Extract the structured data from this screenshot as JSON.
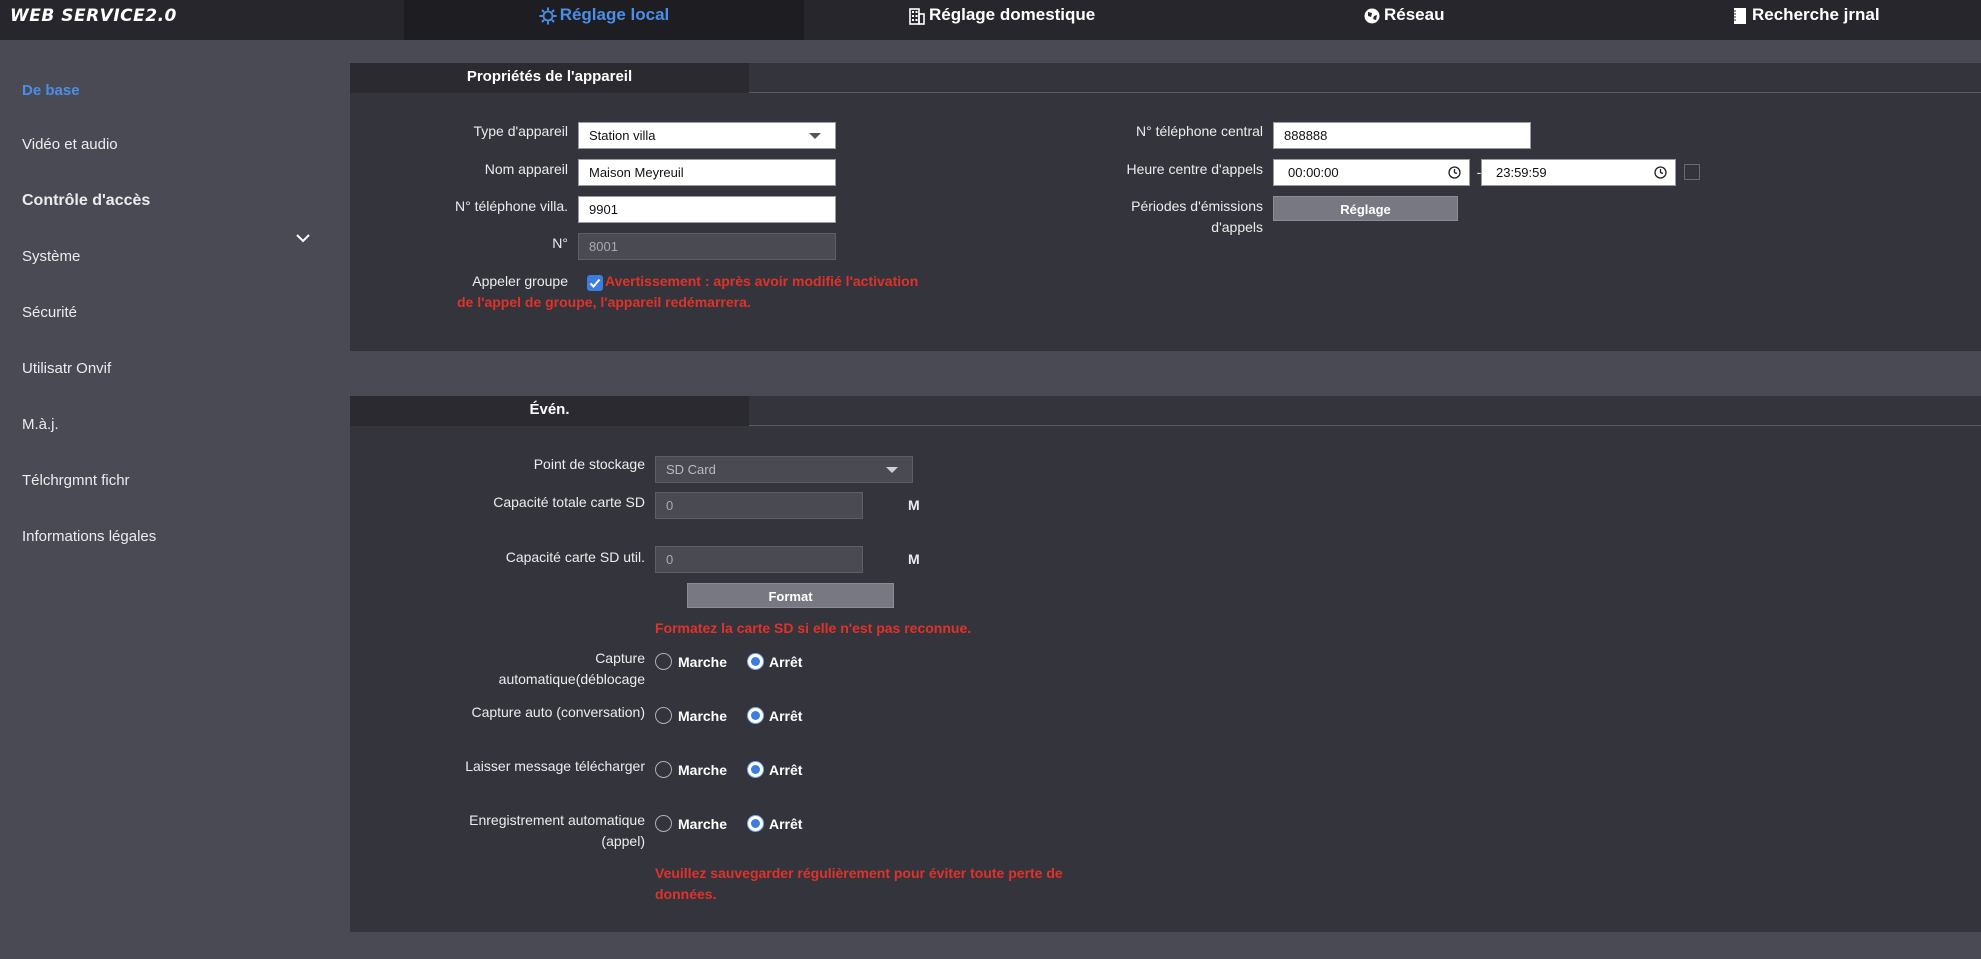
{
  "brand": "WEB SERVICE2.0",
  "tabs": {
    "local": "Réglage local",
    "domestic": "Réglage domestique",
    "network": "Réseau",
    "log": "Recherche jrnal"
  },
  "sidebar": {
    "items": [
      "De base",
      "Vidéo et audio",
      "Contrôle d'accès",
      "Système",
      "Sécurité",
      "Utilisatr Onvif",
      "M.à.j.",
      "Télchrgmnt fichr",
      "Informations légales"
    ]
  },
  "device": {
    "tab": "Propriétés de l'appareil",
    "type_label": "Type d'appareil",
    "type_value": "Station villa",
    "name_label": "Nom appareil",
    "name_value": "Maison Meyreuil",
    "villa_label": "N° téléphone villa.",
    "villa_value": "9901",
    "no_label": "N°",
    "no_value": "8001",
    "group_label": "Appeler groupe",
    "group_warning": "Avertissement : après avoir modifié l'activation de l'appel de groupe, l'appareil redémarrera.",
    "group_checked": true,
    "central_label": "N° téléphone central",
    "central_value": "888888",
    "hours_label": "Heure centre d'appels",
    "hours_start": "00:00:00",
    "hours_sep": "-",
    "hours_end": "23:59:59",
    "periods_label": "Périodes d'émissions d'appels",
    "periods_button": "Réglage"
  },
  "event": {
    "tab": "Évén.",
    "storage_label": "Point de stockage",
    "storage_value": "SD Card",
    "total_label": "Capacité totale carte SD",
    "total_value": "0",
    "used_label": "Capacité carte SD util.",
    "used_value": "0",
    "unit": "M",
    "format_button": "Format",
    "format_hint": "Formatez la carte SD si elle n'est pas reconnue.",
    "on_label": "Marche",
    "off_label": "Arrêt",
    "options": [
      {
        "label": "Capture automatique(déblocage",
        "value": "Arrêt"
      },
      {
        "label": "Capture auto (conversation)",
        "value": "Arrêt"
      },
      {
        "label": "Laisser message télécharger",
        "value": "Arrêt"
      },
      {
        "label": "Enregistrement automatique (appel)",
        "value": "Arrêt"
      }
    ],
    "save_hint": "Veuillez sauvegarder régulièrement pour éviter toute perte de données."
  },
  "colors": {
    "accent": "#4a8ee6",
    "warning": "#e0322a",
    "background": "#4a4a55",
    "panel": "#34343c"
  }
}
